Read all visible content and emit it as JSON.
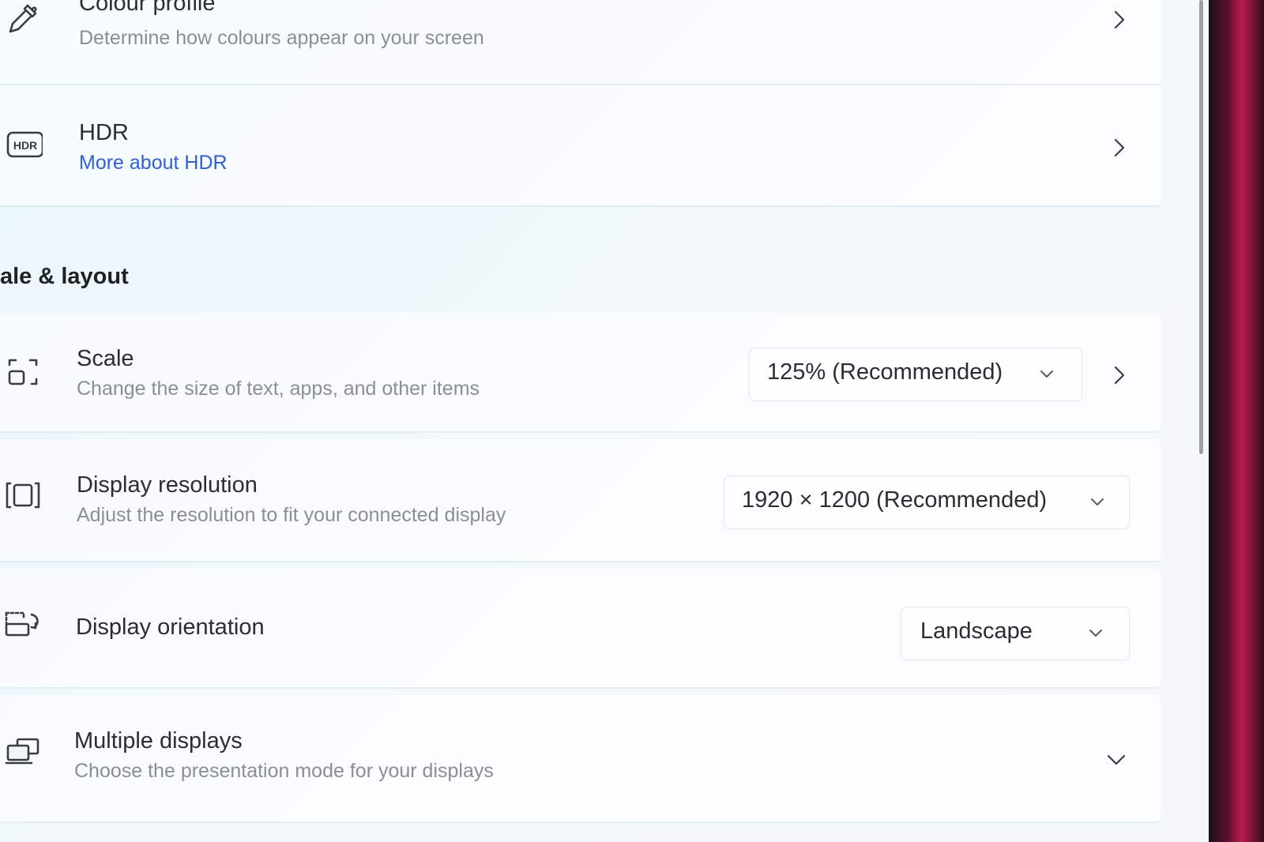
{
  "colour_profile": {
    "title": "Colour profile",
    "description": "Determine how colours appear on your screen",
    "icon": "eyedropper-icon"
  },
  "hdr": {
    "title": "HDR",
    "link": "More about HDR",
    "icon": "hdr-icon",
    "icon_text": "HDR"
  },
  "section": {
    "heading": "ale & layout"
  },
  "scale": {
    "title": "Scale",
    "description": "Change the size of text, apps, and other items",
    "value": "125% (Recommended)",
    "icon": "scale-icon"
  },
  "resolution": {
    "title": "Display resolution",
    "description": "Adjust the resolution to fit your connected display",
    "value": "1920 × 1200 (Recommended)",
    "icon": "resolution-icon"
  },
  "orientation": {
    "title": "Display orientation",
    "value": "Landscape",
    "icon": "rotate-display-icon"
  },
  "multiple_displays": {
    "title": "Multiple displays",
    "description": "Choose the presentation mode for your displays",
    "icon": "multiple-displays-icon"
  },
  "colors": {
    "link": "#2f5fd0",
    "title_text": "#2b2e31",
    "subtitle_text": "#8a8f94"
  }
}
